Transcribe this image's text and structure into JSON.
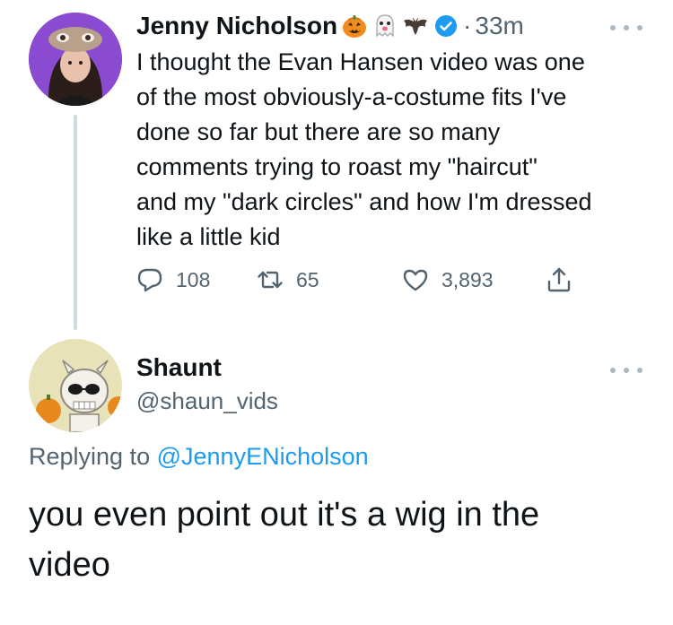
{
  "original_tweet": {
    "author": {
      "display_name": "Jenny Nicholson",
      "emojis": [
        "jack-o-lantern-icon",
        "ghost-icon",
        "bat-icon"
      ],
      "verified": true
    },
    "dot": "·",
    "time": "33m",
    "text_lines": [
      "I thought the Evan Hansen video was one",
      "of the most obviously-a-costume fits I've",
      "done so far but there are so many",
      "comments trying to roast my \"haircut\"",
      "and my \"dark circles\" and how I'm dressed",
      "like a little kid"
    ],
    "actions": {
      "replies": "108",
      "retweets": "65",
      "likes": "3,893"
    }
  },
  "reply_tweet": {
    "author": {
      "display_name": "Shaunt",
      "handle": "@shaun_vids"
    },
    "replying_prefix": "Replying to",
    "replying_to": "@JennyENicholson",
    "text_lines": [
      "you even point out it's a wig in the",
      "video"
    ]
  },
  "colors": {
    "text_primary": "#0f1419",
    "text_secondary": "#536471",
    "link": "#1d9bf0",
    "thread_line": "#cfd9de",
    "verified": "#1d9bf0"
  }
}
